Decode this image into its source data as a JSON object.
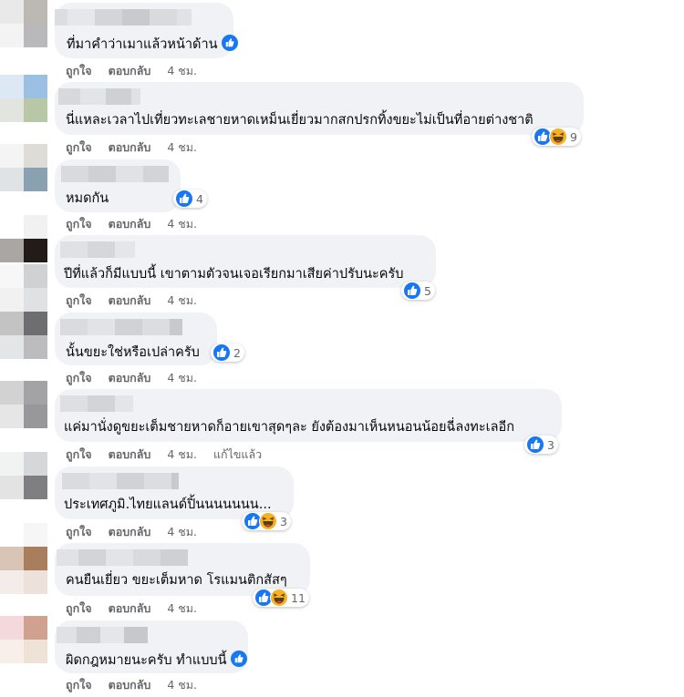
{
  "actions": {
    "like": "ถูกใจ",
    "reply": "ตอบกลับ"
  },
  "comments": [
    {
      "text": "ที่มาคำว่าเมาแล้วหน้าด้าน",
      "time": "4 ชม.",
      "edited": "",
      "reaction_count": ""
    },
    {
      "text": "นี่แหละเวลาไปเที่ยวทะเลชายหาดเหม็นเยี่ยวมากสกปรกทิ้งขยะไม่เป็นที่อายต่างชาติ",
      "time": "4 ชม.",
      "edited": "",
      "reaction_count": "9"
    },
    {
      "text": "หมดกัน",
      "time": "4 ชม.",
      "edited": "",
      "reaction_count": "4"
    },
    {
      "text": "ปีที่แล้วก็มีแบบนี้ เขาตามตัวจนเจอเรียกมาเสียค่าปรับนะครับ",
      "time": "4 ชม.",
      "edited": "",
      "reaction_count": "5"
    },
    {
      "text": "นั้นขยะใช่หรือเปล่าครับ",
      "time": "4 ชม.",
      "edited": "",
      "reaction_count": "2"
    },
    {
      "text": "แค่มานั่งดูขยะเต็มชายหาดก็อายเขาสุดๆละ ยังต้องมาเห็นหนอนน้อยฉี่ลงทะเลอีก",
      "time": "4 ชม.",
      "edited": "แก้ไขแล้ว",
      "reaction_count": "3"
    },
    {
      "text": "ประเทศภูมิ.ไทยแลนด์ปิ้นนนนนนน...",
      "time": "4 ชม.",
      "edited": "",
      "reaction_count": "3"
    },
    {
      "text": "คนยืนเยี่ยว ขยะเต็มหาด โรแมนติกสัสๆ",
      "time": "4 ชม.",
      "edited": "",
      "reaction_count": "11"
    },
    {
      "text": "ผิดกฎหมายนะครับ ทำแบบนี้",
      "time": "4 ชม.",
      "edited": "",
      "reaction_count": ""
    }
  ],
  "colors": {
    "bubble": "#f0f2f5",
    "like_blue": "#1877f2",
    "haha_yellow": "#f7b125",
    "meta_gray": "#65676b"
  }
}
